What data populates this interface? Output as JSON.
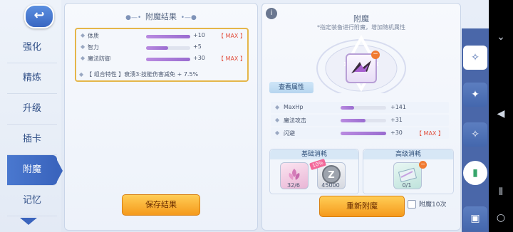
{
  "nav": {
    "back_icon": "back-arrow-icon",
    "items": [
      {
        "label": "强化"
      },
      {
        "label": "精炼"
      },
      {
        "label": "升级"
      },
      {
        "label": "插卡"
      },
      {
        "label": "附魔"
      },
      {
        "label": "记忆"
      }
    ],
    "active_index": 4
  },
  "result_panel": {
    "title": "附魔结果",
    "stats": [
      {
        "name": "体质",
        "fill": 1.0,
        "value": "+10",
        "max": "【 MAX 】"
      },
      {
        "name": "智力",
        "fill": 0.5,
        "value": "+5",
        "max": ""
      },
      {
        "name": "魔法防御",
        "fill": 1.0,
        "value": "+30",
        "max": "【 MAX 】"
      }
    ],
    "combo": "【 组合特性 】衰溃3:技能伤害减免 + 7.5%",
    "save_button": "保存结果"
  },
  "enchant_panel": {
    "info_icon": "i",
    "title": "附魔",
    "subtitle": "*指定装备进行附魔，增加随机属性",
    "view_attrs": "查看属性",
    "attrs": [
      {
        "name": "MaxHp",
        "fill": 0.3,
        "value": "+141",
        "max": ""
      },
      {
        "name": "魔法攻击",
        "fill": 0.55,
        "value": "+31",
        "max": ""
      },
      {
        "name": "闪避",
        "fill": 1.0,
        "value": "+30",
        "max": "【 MAX 】"
      }
    ],
    "basic_cost": {
      "title": "基础消耗",
      "items": [
        {
          "icon": "flower-material-icon",
          "count": "32/6"
        },
        {
          "icon": "zeny-coin-icon",
          "count": "45000",
          "badge": "10%"
        }
      ]
    },
    "advanced_cost": {
      "title": "高级消耗",
      "items": [
        {
          "icon": "scroll-material-icon",
          "count": "0/1"
        }
      ]
    },
    "reenchant_button": "重新附魔",
    "batch_label": "附魔10次"
  },
  "colors": {
    "accent": "#3a64bd",
    "button_orange": "#f59a1c",
    "max_red": "#e2503f",
    "bar_purple": "#9a6cd0",
    "highlight_gold": "#e5b64a"
  }
}
